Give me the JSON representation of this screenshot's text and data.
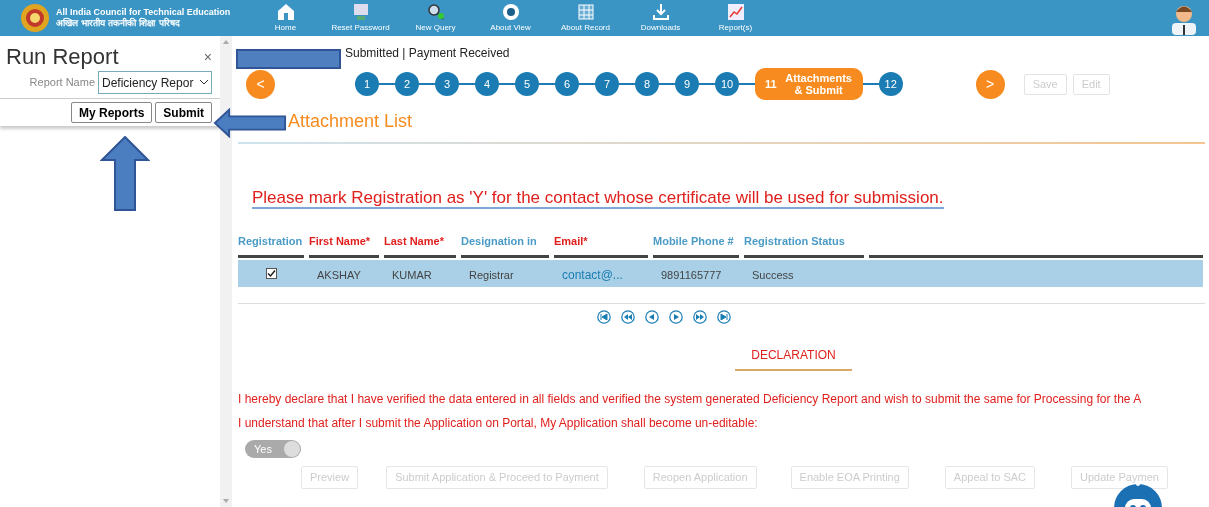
{
  "header": {
    "org_name": "All India Council for Technical Education",
    "org_name_hindi": "अखिल भारतीय तकनीकी शिक्षा परिषद",
    "nav": [
      {
        "label": "Home",
        "kind": "home"
      },
      {
        "label": "Reset Password",
        "kind": "monitor"
      },
      {
        "label": "New Query",
        "kind": "search"
      },
      {
        "label": "About View",
        "kind": "eye"
      },
      {
        "label": "About Record",
        "kind": "grid"
      },
      {
        "label": "Downloads",
        "kind": "download"
      },
      {
        "label": "Report(s)",
        "kind": "chart"
      }
    ]
  },
  "run_report": {
    "title": "Run Report",
    "close": "×",
    "report_name_label": "Report Name",
    "report_name_value": "Deficiency Repor",
    "buttons": [
      "My Reports",
      "Submit"
    ]
  },
  "status": "Submitted | Payment Received",
  "steps": {
    "prev": "<",
    "next": ">",
    "items": [
      {
        "number": "1",
        "selected": false
      },
      {
        "number": "2",
        "selected": false
      },
      {
        "number": "3",
        "selected": false
      },
      {
        "number": "4",
        "selected": false
      },
      {
        "number": "5",
        "selected": false
      },
      {
        "number": "6",
        "selected": false
      },
      {
        "number": "7",
        "selected": false
      },
      {
        "number": "8",
        "selected": false
      },
      {
        "number": "9",
        "selected": false
      },
      {
        "number": "10",
        "selected": false
      },
      {
        "number": "11",
        "label": "Attachments & Submit",
        "selected": true
      },
      {
        "number": "12",
        "selected": false
      }
    ],
    "actions": [
      {
        "label": "Save",
        "disabled": true
      },
      {
        "label": "Edit",
        "disabled": true
      }
    ]
  },
  "section_title": "Attachment List",
  "notice": "Please mark Registration as 'Y' for the contact whose certificate will be used for submission.",
  "table": {
    "columns": [
      {
        "label": "Registration",
        "required": false
      },
      {
        "label": "First Name*",
        "required": true
      },
      {
        "label": "Last Name*",
        "required": true
      },
      {
        "label": "Designation in",
        "required": false
      },
      {
        "label": "Email*",
        "required": true
      },
      {
        "label": "Mobile Phone #",
        "required": false
      },
      {
        "label": "Registration Status",
        "required": false
      }
    ],
    "rows": [
      {
        "checked": true,
        "cells": [
          "",
          "AKSHAY",
          "KUMAR",
          "Registrar",
          "contact@...",
          "9891165777",
          "Success"
        ],
        "selected": true
      }
    ]
  },
  "declaration": {
    "title": "DECLARATION",
    "lines": [
      "I hereby declare that I have verified the data entered in all fields and verified the system generated Deficiency Report and wish to submit the same for Processing for the A",
      "I understand that after I submit the Application on Portal, My Application shall become un-editable:"
    ],
    "toggle_label": "Yes",
    "buttons": [
      {
        "label": "Preview",
        "disabled": true
      },
      {
        "label": "Submit Application & Proceed to Payment",
        "disabled": true
      },
      {
        "label": "Reopen Application",
        "disabled": true
      },
      {
        "label": "Enable EOA Printing",
        "disabled": true
      },
      {
        "label": "Appeal to SAC",
        "disabled": true
      },
      {
        "label": "Update Paymen",
        "disabled": true
      }
    ]
  }
}
